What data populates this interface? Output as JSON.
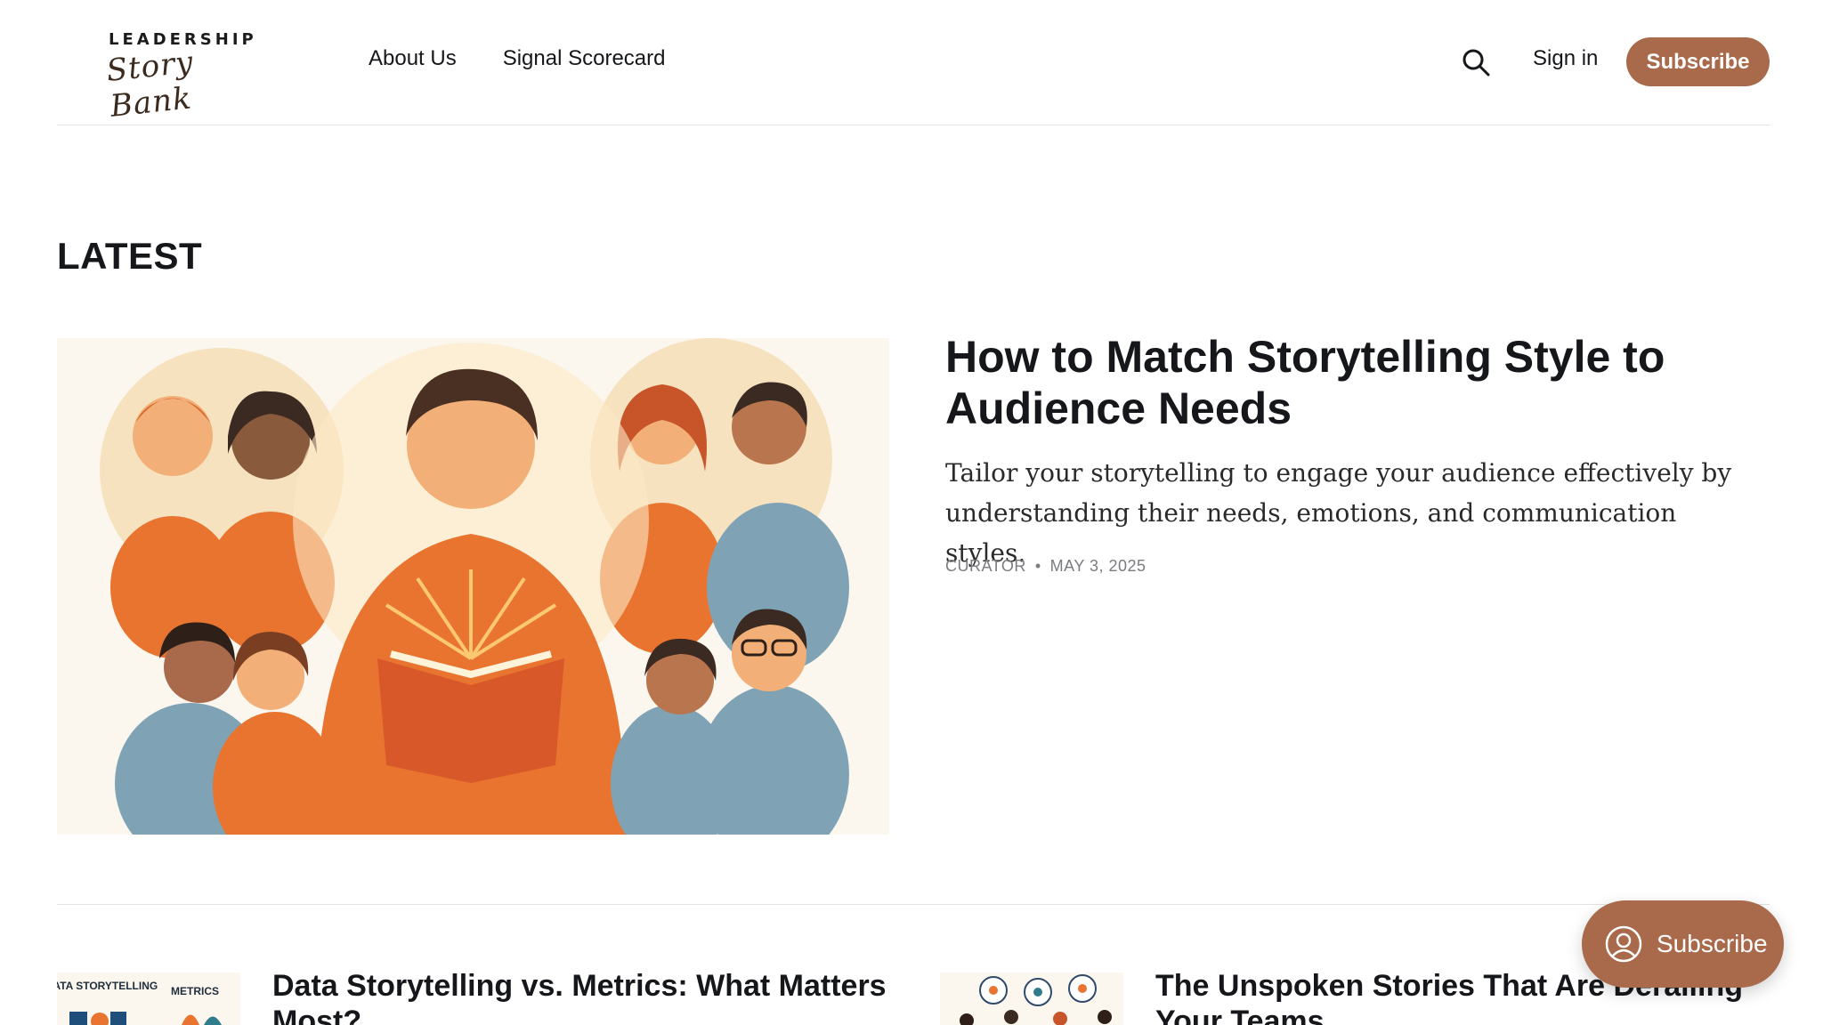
{
  "site": {
    "logo_top": "LEADERSHIP",
    "logo_script": "Story Bank"
  },
  "nav": {
    "items": [
      "About Us",
      "Signal Scorecard"
    ],
    "sign_in": "Sign in",
    "subscribe": "Subscribe"
  },
  "section": {
    "heading": "LATEST"
  },
  "feature": {
    "title": "How to Match Storytelling Style to Audience Needs",
    "excerpt": "Tailor your storytelling to engage your audience effectively by understanding their needs, emotions, and communication styles.",
    "author": "CURATOR",
    "separator": "•",
    "date": "MAY 3, 2025",
    "image_icon": "illustration-reader-with-audience"
  },
  "cards": [
    {
      "title": "Data Storytelling vs. Metrics: What Matters Most?",
      "thumb_label_left": "DATA STORYTELLING",
      "thumb_label_right": "METRICS"
    },
    {
      "title": "The Unspoken Stories That Are Derailing Your Teams"
    }
  ],
  "portal": {
    "label": "Subscribe",
    "icon": "user-circle-icon"
  },
  "colors": {
    "accent": "#a86a4a",
    "text": "#15171a",
    "meta": "#7a7c80",
    "orange": "#e8742f",
    "blue": "#7fa3b5"
  }
}
